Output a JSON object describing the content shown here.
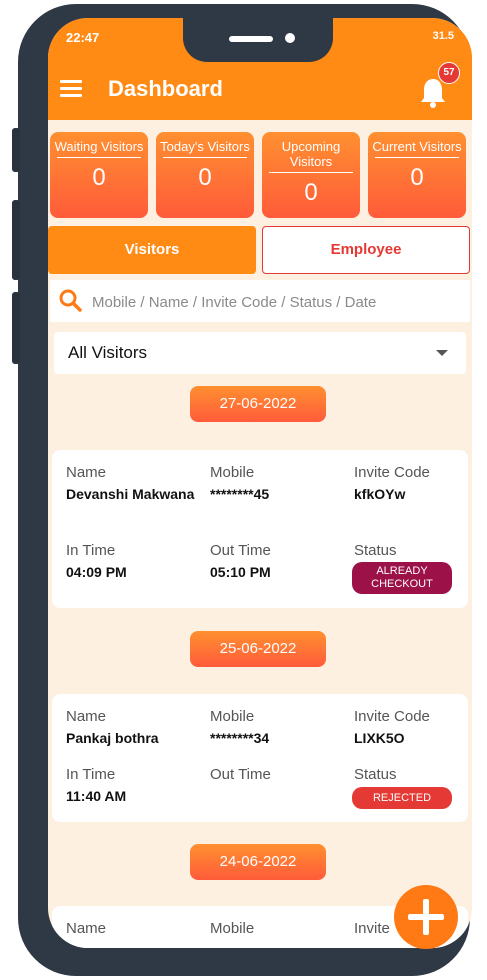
{
  "status_bar": {
    "time": "22:47",
    "right": "31.5"
  },
  "header": {
    "title": "Dashboard",
    "notification_count": "57"
  },
  "stats": [
    {
      "label": "Waiting Visitors",
      "value": "0"
    },
    {
      "label": "Today's Visitors",
      "value": "0"
    },
    {
      "label": "Upcoming Visitors",
      "value": "0"
    },
    {
      "label": "Current Visitors",
      "value": "0"
    }
  ],
  "tabs": {
    "visitors": "Visitors",
    "employee": "Employee"
  },
  "search": {
    "placeholder": "Mobile / Name / Invite Code / Status / Date"
  },
  "filter": {
    "selected": "All Visitors"
  },
  "labels": {
    "name": "Name",
    "mobile": "Mobile",
    "invite": "Invite Code",
    "in_time": "In Time",
    "out_time": "Out Time",
    "status": "Status",
    "invite_cut": "Invite"
  },
  "groups": [
    {
      "date": "27-06-2022",
      "visitor": {
        "name": "Devanshi Makwana",
        "mobile": "********45",
        "invite_code": "kfkOYw",
        "in_time": "04:09 PM",
        "out_time": "05:10 PM",
        "status": "ALREADY CHECKOUT"
      }
    },
    {
      "date": "25-06-2022",
      "visitor": {
        "name": "Pankaj bothra",
        "mobile": "********34",
        "invite_code": "LIXK5O",
        "in_time": "11:40 AM",
        "out_time": "",
        "status": "REJECTED"
      }
    },
    {
      "date": "24-06-2022"
    }
  ],
  "colors": {
    "accent": "#ff8a14",
    "rejected": "#e53935",
    "checkout": "#9c1148",
    "page_bg": "#fdf0e1"
  }
}
